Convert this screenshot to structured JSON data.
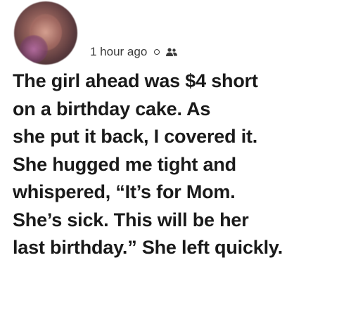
{
  "post": {
    "timestamp": "1 hour ago",
    "privacy_icon": "people-icon",
    "separator_icon": "dot-icon",
    "avatar_icon": "avatar",
    "lines": [
      "The girl ahead was $4 short",
      "on a birthday cake. As",
      "she put it back, I covered it.",
      "She hugged me tight and",
      "whispered, “It’s for Mom.",
      "She’s sick. This will be her",
      "last birthday.” She left quickly."
    ]
  }
}
